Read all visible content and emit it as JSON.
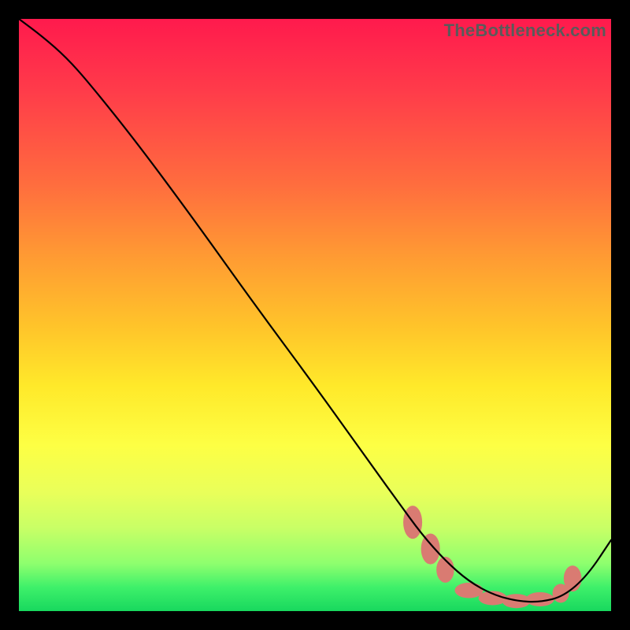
{
  "watermark": "TheBottleneck.com",
  "chart_data": {
    "type": "line",
    "title": "",
    "xlabel": "",
    "ylabel": "",
    "xlim": [
      0,
      100
    ],
    "ylim": [
      0,
      100
    ],
    "grid": false,
    "series": [
      {
        "name": "curve",
        "x": [
          0,
          4,
          8,
          12,
          20,
          30,
          40,
          50,
          60,
          64,
          68,
          72,
          76,
          80,
          84,
          88,
          92,
          96,
          100
        ],
        "y": [
          100,
          97,
          93.5,
          89,
          79,
          65.5,
          51.5,
          38,
          24,
          18.5,
          13,
          8.5,
          5,
          2.8,
          1.7,
          1.5,
          2.5,
          6,
          12
        ],
        "stroke": "#000000",
        "stroke_width": 2.2
      }
    ],
    "markers": [
      {
        "name": "trough-marker",
        "shape": "ellipse",
        "cx": 66.5,
        "cy": 15.0,
        "rx": 1.6,
        "ry": 2.8,
        "fill": "#d97b72"
      },
      {
        "name": "trough-marker",
        "shape": "ellipse",
        "cx": 69.5,
        "cy": 10.5,
        "rx": 1.6,
        "ry": 2.6,
        "fill": "#d97b72"
      },
      {
        "name": "trough-marker",
        "shape": "ellipse",
        "cx": 72.0,
        "cy": 7.0,
        "rx": 1.5,
        "ry": 2.2,
        "fill": "#d97b72"
      },
      {
        "name": "trough-marker",
        "shape": "ellipse",
        "cx": 76.0,
        "cy": 3.5,
        "rx": 2.4,
        "ry": 1.3,
        "fill": "#d97b72"
      },
      {
        "name": "trough-marker",
        "shape": "ellipse",
        "cx": 80.0,
        "cy": 2.2,
        "rx": 2.4,
        "ry": 1.2,
        "fill": "#d97b72"
      },
      {
        "name": "trough-marker",
        "shape": "ellipse",
        "cx": 84.0,
        "cy": 1.7,
        "rx": 2.4,
        "ry": 1.2,
        "fill": "#d97b72"
      },
      {
        "name": "trough-marker",
        "shape": "ellipse",
        "cx": 88.0,
        "cy": 2.0,
        "rx": 2.4,
        "ry": 1.2,
        "fill": "#d97b72"
      },
      {
        "name": "trough-marker",
        "shape": "ellipse",
        "cx": 91.5,
        "cy": 3.0,
        "rx": 1.4,
        "ry": 1.6,
        "fill": "#d97b72"
      },
      {
        "name": "trough-marker",
        "shape": "ellipse",
        "cx": 93.5,
        "cy": 5.5,
        "rx": 1.5,
        "ry": 2.2,
        "fill": "#d97b72"
      }
    ]
  }
}
